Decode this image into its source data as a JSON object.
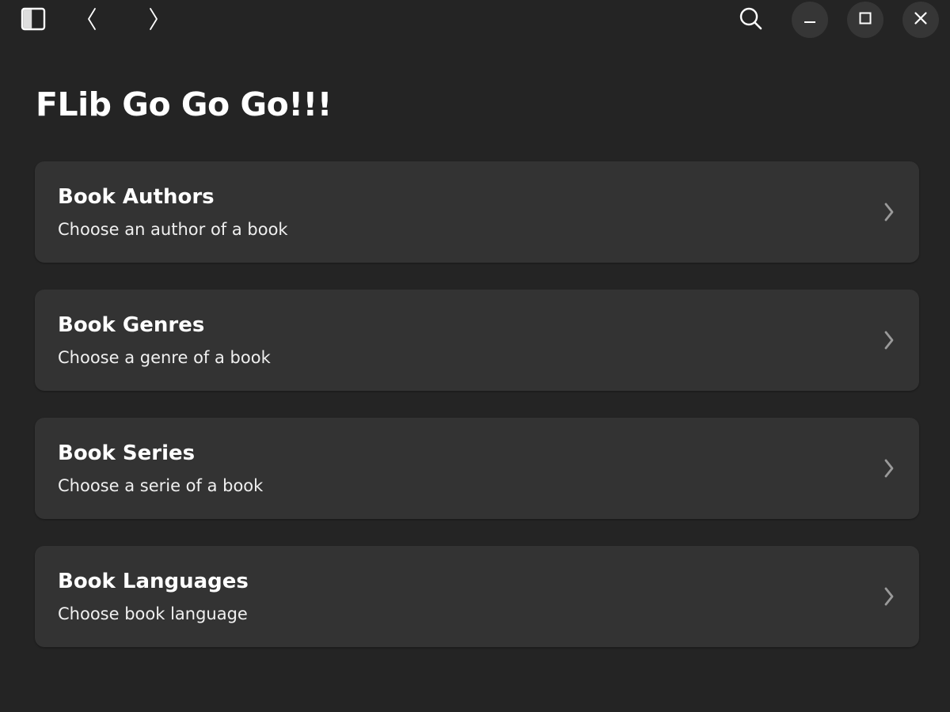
{
  "header": {
    "icons": {
      "sidebar": "sidebar-toggle-icon",
      "back": "chevron-left-icon",
      "forward": "chevron-right-icon",
      "search": "search-icon",
      "minimize": "minimize-icon",
      "maximize": "maximize-icon",
      "close": "close-icon"
    }
  },
  "main": {
    "title": "FLib Go Go Go!!!",
    "items": [
      {
        "title": "Book Authors",
        "subtitle": "Choose an author of a book"
      },
      {
        "title": "Book Genres",
        "subtitle": "Choose a genre of a book"
      },
      {
        "title": "Book Series",
        "subtitle": "Choose a serie of a book"
      },
      {
        "title": "Book Languages",
        "subtitle": "Choose book language"
      }
    ]
  },
  "colors": {
    "window_bg": "#242424",
    "row_bg": "#333333",
    "button_bg": "#363636",
    "text": "#ffffff",
    "chevron": "#9a9a9a"
  }
}
